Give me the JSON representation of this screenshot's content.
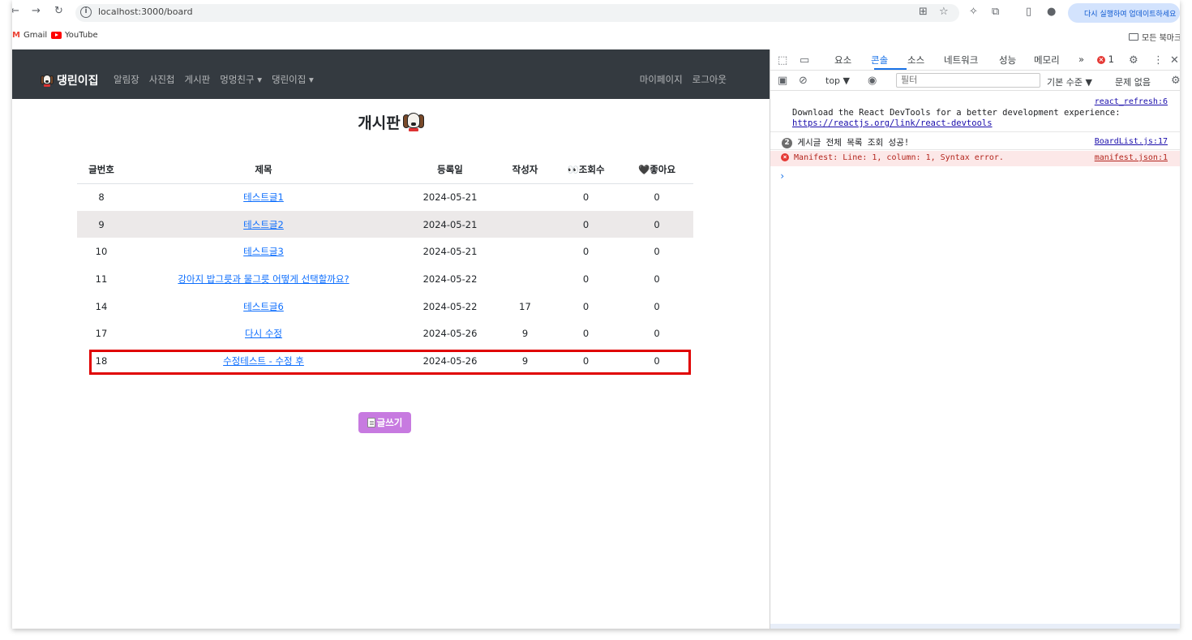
{
  "browser": {
    "url": "localhost:3000/board",
    "update_text": "다시 실행하여 업데이트하세요",
    "bookmarks": [
      {
        "label": "Gmail"
      },
      {
        "label": "YouTube"
      }
    ],
    "all_bookmarks": "모든 북마크"
  },
  "app": {
    "brand": "댕린이집",
    "nav": [
      {
        "label": "알림장"
      },
      {
        "label": "사진첩"
      },
      {
        "label": "게시판"
      },
      {
        "label": "멍멍친구 ▾"
      },
      {
        "label": "댕린이집 ▾"
      }
    ],
    "nav_right": [
      {
        "label": "마이페이지"
      },
      {
        "label": "로그아웃"
      }
    ],
    "page_title": "개시판",
    "table": {
      "headers": [
        "글번호",
        "제목",
        "등록일",
        "작성자",
        "👀조회수",
        "🖤좋아요"
      ],
      "rows": [
        {
          "no": "8",
          "title": "테스트글1",
          "date": "2024-05-21",
          "author": "",
          "views": "0",
          "likes": "0"
        },
        {
          "no": "9",
          "title": "테스트글2",
          "date": "2024-05-21",
          "author": "",
          "views": "0",
          "likes": "0"
        },
        {
          "no": "10",
          "title": "테스트글3",
          "date": "2024-05-21",
          "author": "",
          "views": "0",
          "likes": "0"
        },
        {
          "no": "11",
          "title": "강아지 밥그릇과 물그릇 어떻게 선택할까요?",
          "date": "2024-05-22",
          "author": "",
          "views": "0",
          "likes": "0"
        },
        {
          "no": "14",
          "title": "테스트글6",
          "date": "2024-05-22",
          "author": "17",
          "views": "0",
          "likes": "0"
        },
        {
          "no": "17",
          "title": "다시 수정",
          "date": "2024-05-26",
          "author": "9",
          "views": "0",
          "likes": "0"
        },
        {
          "no": "18",
          "title": "수정테스트 - 수정 후",
          "date": "2024-05-26",
          "author": "9",
          "views": "0",
          "likes": "0"
        }
      ]
    },
    "write_button": "글쓰기"
  },
  "devtools": {
    "tabs": [
      "요소",
      "콘솔",
      "소스",
      "네트워크",
      "성능",
      "메모리"
    ],
    "active_tab": "콘솔",
    "error_count": "1",
    "context": "top ▼",
    "filter_placeholder": "필터",
    "level": "기본 수준 ▼",
    "issues": "문제 없음",
    "messages": [
      {
        "text": "Download the React DevTools for a better development experience:",
        "link": "https://reactjs.org/link/react-devtools",
        "source": "react_refresh:6"
      },
      {
        "count": "2",
        "text": "게시글 전체 목록 조회 성공!",
        "source": "BoardList.js:17"
      },
      {
        "text": "Manifest: Line: 1, column: 1, Syntax error.",
        "source": "manifest.json:1"
      }
    ],
    "prompt": "›"
  },
  "colors": {
    "navbar_bg": "#343a40",
    "link": "#0d6efd",
    "highlight": "#e00000",
    "write_button": "#c77ae0",
    "devtools_accent": "#1a73e8"
  }
}
